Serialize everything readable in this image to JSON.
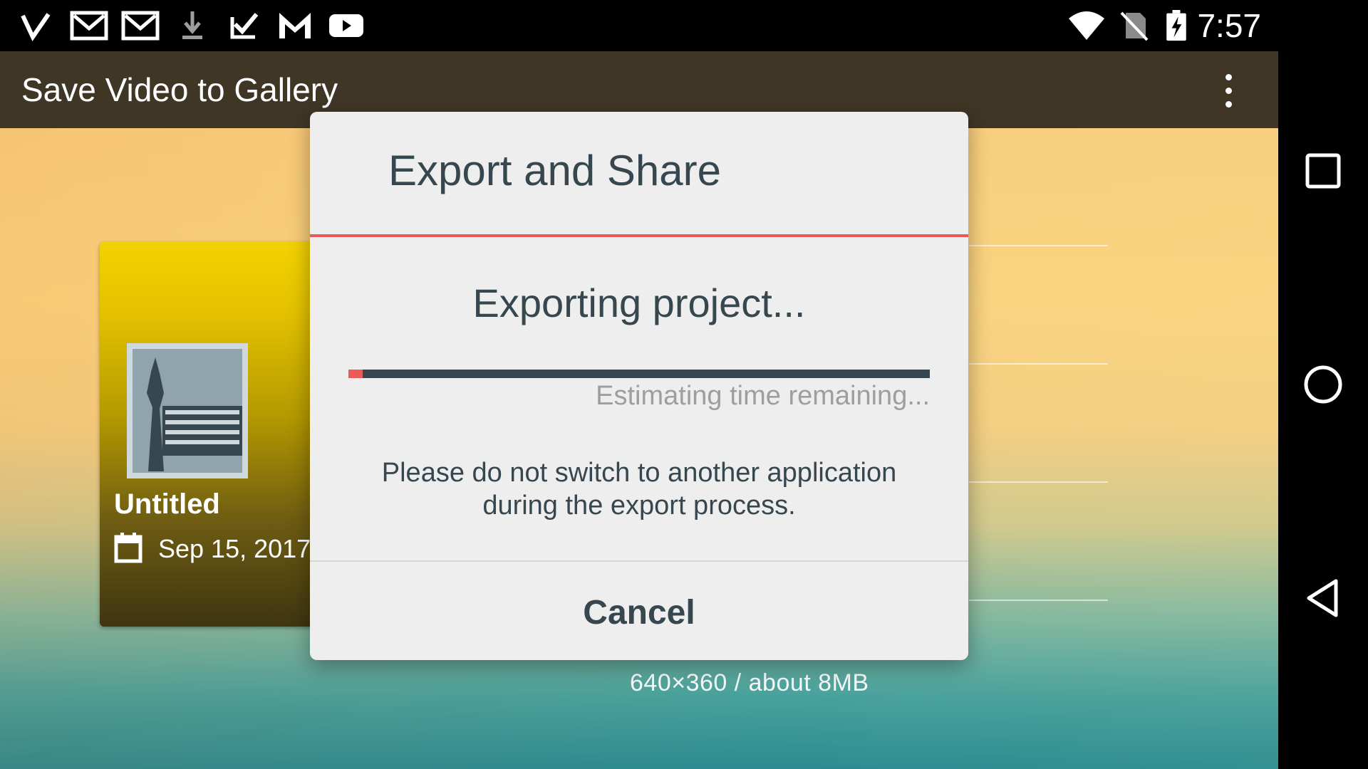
{
  "status_bar": {
    "time": "7:57",
    "left_icons": [
      "vimeo-icon",
      "gmail-icon",
      "gmail-icon",
      "download-icon",
      "task-check-icon",
      "gmail-icon",
      "youtube-icon"
    ],
    "right_icons": [
      "wifi-icon",
      "no-sim-icon",
      "battery-charging-icon"
    ]
  },
  "toolbar": {
    "title": "Save Video to Gallery",
    "menu_icon": "more-vert-icon"
  },
  "project": {
    "title": "Untitled",
    "date": "Sep 15, 2017",
    "date_icon": "calendar-icon",
    "size_info": "640×360 / about 8MB"
  },
  "dialog": {
    "title": "Export and Share",
    "status": "Exporting project...",
    "progress": 0.025,
    "eta": "Estimating time remaining...",
    "warning": "Please do not switch to another application during the export process.",
    "cancel_label": "Cancel",
    "accent_color": "#e85a5a"
  },
  "nav_bar": {
    "buttons": [
      "recents-icon",
      "home-icon",
      "back-icon"
    ]
  }
}
